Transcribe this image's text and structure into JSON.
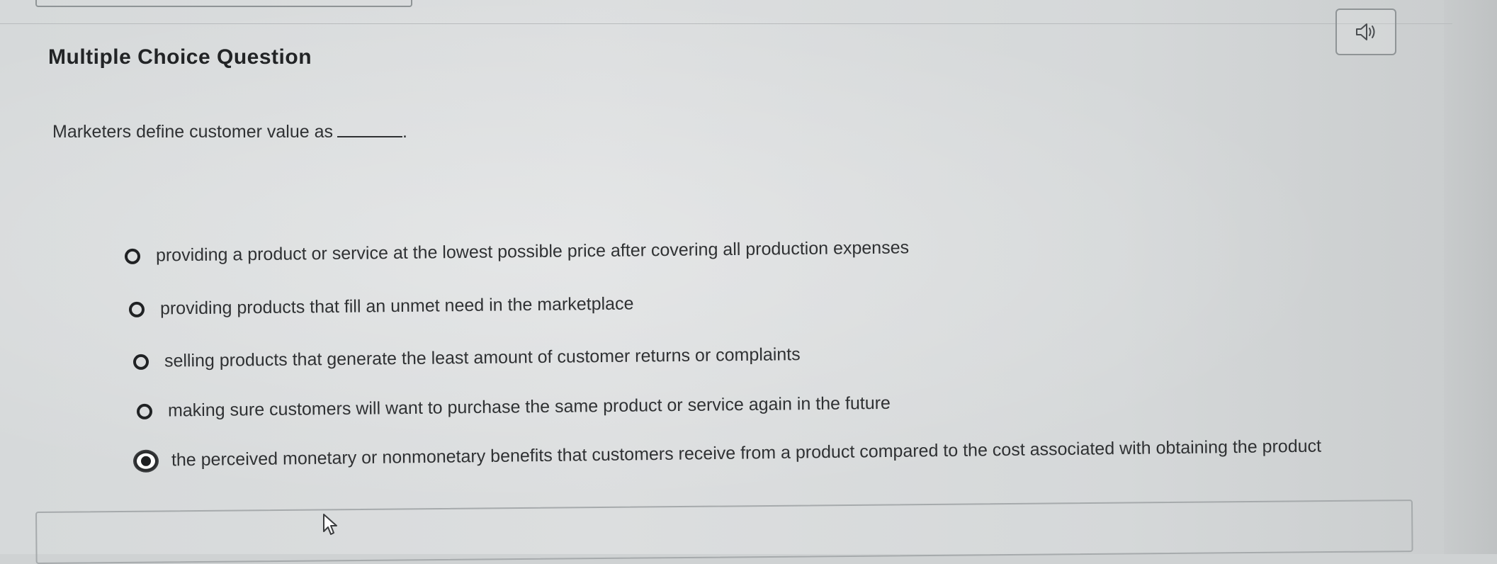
{
  "title": "Multiple Choice Question",
  "question": {
    "text": "Marketers define customer value as",
    "trailing": "."
  },
  "audio_button": {
    "icon": "speaker-icon"
  },
  "choices": [
    {
      "label": "providing a product or service at the lowest possible price after covering all production expenses",
      "selected": false
    },
    {
      "label": "providing products that fill an unmet need in the marketplace",
      "selected": false
    },
    {
      "label": "selling products that generate the least amount of customer returns or complaints",
      "selected": false
    },
    {
      "label": "making sure customers will want to purchase the same product or service again in the future",
      "selected": false
    },
    {
      "label": "the perceived monetary or nonmonetary benefits that customers receive from a product compared to the cost associated with obtaining the product",
      "selected": true
    }
  ]
}
